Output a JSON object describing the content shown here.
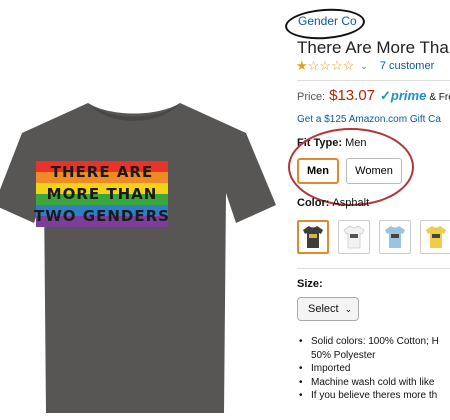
{
  "product": {
    "brand": "Gender Co",
    "title": "There Are More Tha",
    "rating_count": "7 customer",
    "price_label": "Price:",
    "price": "$13.07",
    "prime_check": "✓",
    "prime": "prime",
    "free_shipping": "& Free",
    "gift_offer": "Get a $125 Amazon.com Gift Ca",
    "rating_stars_filled": 1,
    "rating_stars_total": 5
  },
  "shirt": {
    "print_lines": [
      "THERE ARE",
      "MORE THAN",
      "TWO GENDERS"
    ],
    "colors": {
      "body": "#585655",
      "collar": "#4a4847",
      "stripes": [
        "#e7332a",
        "#f08a24",
        "#f2d21b",
        "#3ba63b",
        "#2f7fc4",
        "#7b3e99"
      ]
    }
  },
  "fit": {
    "label": "Fit Type:",
    "selected": "Men",
    "options": [
      "Men",
      "Women"
    ]
  },
  "color": {
    "label": "Color:",
    "selected": "Asphalt",
    "swatches": [
      {
        "name": "asphalt",
        "hex": "#3d3d3d"
      },
      {
        "name": "white",
        "hex": "#f2f2f2"
      },
      {
        "name": "light-blue",
        "hex": "#9cc3e0"
      },
      {
        "name": "yellow",
        "hex": "#f0cc4a"
      }
    ]
  },
  "size": {
    "label": "Size:",
    "select_value": "Select"
  },
  "bullets": [
    "Solid colors: 100% Cotton; H",
    "50% Polyester",
    "Imported",
    "Machine wash cold with like",
    "If you believe theres more th"
  ],
  "colors": {
    "link": "#0a5aa8",
    "price": "#b12704",
    "selected_border": "#e08a2c",
    "annotation_red": "#b33535"
  }
}
